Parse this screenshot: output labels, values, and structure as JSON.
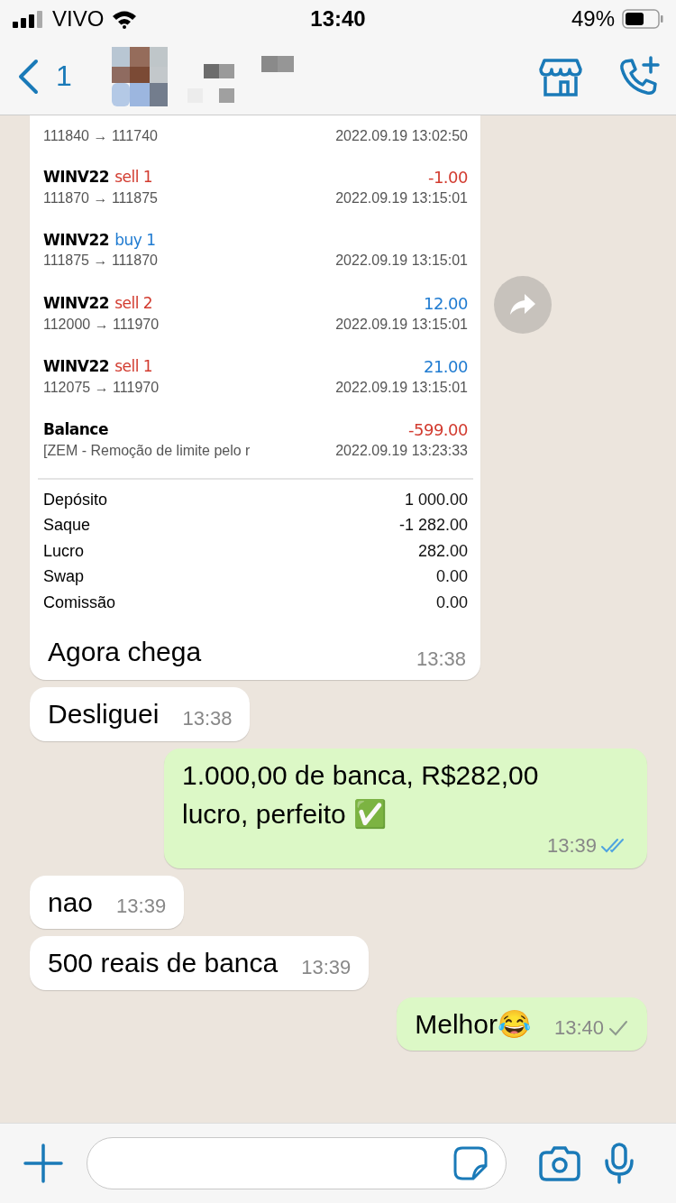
{
  "status_bar": {
    "carrier": "VIVO",
    "time": "13:40",
    "battery": "49%"
  },
  "header": {
    "back_count": "1"
  },
  "chat": {
    "messages": [
      {
        "kind": "screenshot",
        "trades_partial": {
          "prices": "111840 → 111740",
          "time": "2022.09.19 13:02:50"
        },
        "trades": [
          {
            "kind": "sell",
            "symbol": "WINV22",
            "side": "sell 1",
            "amount": "-1.00",
            "loss": true,
            "prices": "111870 → 111875",
            "time": "2022.09.19 13:15:01"
          },
          {
            "kind": "buy",
            "symbol": "WINV22",
            "side": "buy 1",
            "prices": "111875 → 111870",
            "time": "2022.09.19 13:15:01"
          },
          {
            "kind": "sell",
            "symbol": "WINV22",
            "side": "sell 2",
            "amount": "12.00",
            "loss": false,
            "prices": "112000 → 111970",
            "time": "2022.09.19 13:15:01"
          },
          {
            "kind": "sell",
            "symbol": "WINV22",
            "side": "sell 1",
            "amount": "21.00",
            "loss": false,
            "prices": "112075 → 111970",
            "time": "2022.09.19 13:15:01"
          },
          {
            "kind": "balance",
            "symbol": "Balance",
            "amount": "-599.00",
            "loss": true,
            "prices": "[ZEM - Remoção de limite pelo r",
            "time": "2022.09.19 13:23:33"
          }
        ],
        "summary": [
          {
            "label": "Depósito",
            "value": "1 000.00"
          },
          {
            "label": "Saque",
            "value": "-1 282.00"
          },
          {
            "label": "Lucro",
            "value": "282.00"
          },
          {
            "label": "Swap",
            "value": "0.00"
          },
          {
            "label": "Comissão",
            "value": "0.00"
          }
        ],
        "text": "Agora chega",
        "time": "13:38"
      },
      {
        "kind": "incoming",
        "text": "Desliguei",
        "time": "13:38"
      },
      {
        "kind": "outgoing",
        "text": "1.000,00 de banca, R$282,00 lucro, perfeito ✅",
        "time": "13:39",
        "read": true
      },
      {
        "kind": "incoming",
        "text": "nao",
        "time": "13:39"
      },
      {
        "kind": "incoming",
        "text": "500 reais de banca",
        "time": "13:39"
      },
      {
        "kind": "outgoing",
        "text": "Melhor😂",
        "time": "13:40",
        "read": false
      }
    ]
  }
}
